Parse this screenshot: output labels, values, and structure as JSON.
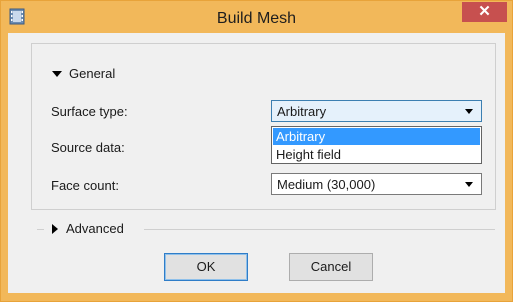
{
  "window": {
    "title": "Build Mesh",
    "close_glyph": "✕",
    "accent": "#f2b85a",
    "close_color": "#c7504f"
  },
  "general": {
    "legend": "General",
    "fields": [
      {
        "label": "Surface type:",
        "value": "Arbitrary"
      },
      {
        "label": "Source data:"
      },
      {
        "label": "Face count:",
        "value": "Medium (30,000)"
      }
    ],
    "surface_options": [
      "Arbitrary",
      "Height field"
    ],
    "selected_option": "Arbitrary"
  },
  "advanced": {
    "legend": "Advanced"
  },
  "buttons": {
    "ok": "OK",
    "cancel": "Cancel"
  }
}
